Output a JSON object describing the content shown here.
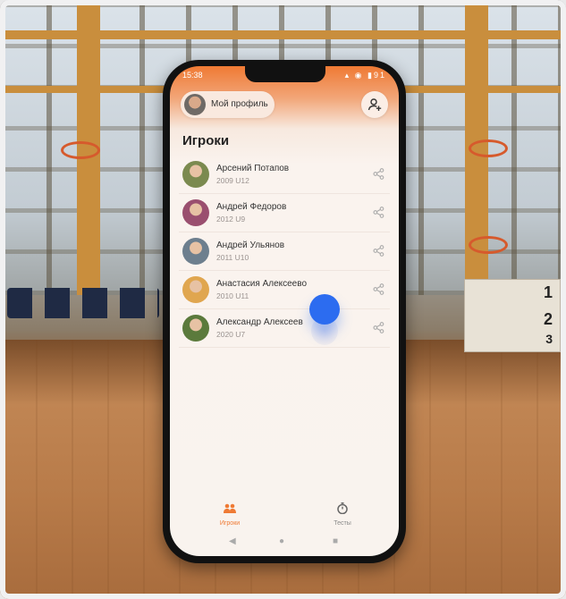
{
  "status_bar": {
    "time": "15:38",
    "battery": "91"
  },
  "header": {
    "profile_label": "Мой профиль",
    "title": "Игроки"
  },
  "players": [
    {
      "name": "Арсений Потапов",
      "meta": "2009 U12",
      "avatar_color": "#7b8a4f"
    },
    {
      "name": "Андрей Федоров",
      "meta": "2012 U9",
      "avatar_color": "#9a4f6f"
    },
    {
      "name": "Андрей Ульянов",
      "meta": "2011 U10",
      "avatar_color": "#6d7f8e"
    },
    {
      "name": "Анастасия Алексеево",
      "meta": "2010 U11",
      "avatar_color": "#e0a64f"
    },
    {
      "name": "Александр Алексеев",
      "meta": "2020 U7",
      "avatar_color": "#5b7a3c"
    }
  ],
  "tabs": {
    "players": "Игроки",
    "tests": "Тесты"
  },
  "colors": {
    "accent": "#ef7a34",
    "touch": "#2c6cf0"
  }
}
